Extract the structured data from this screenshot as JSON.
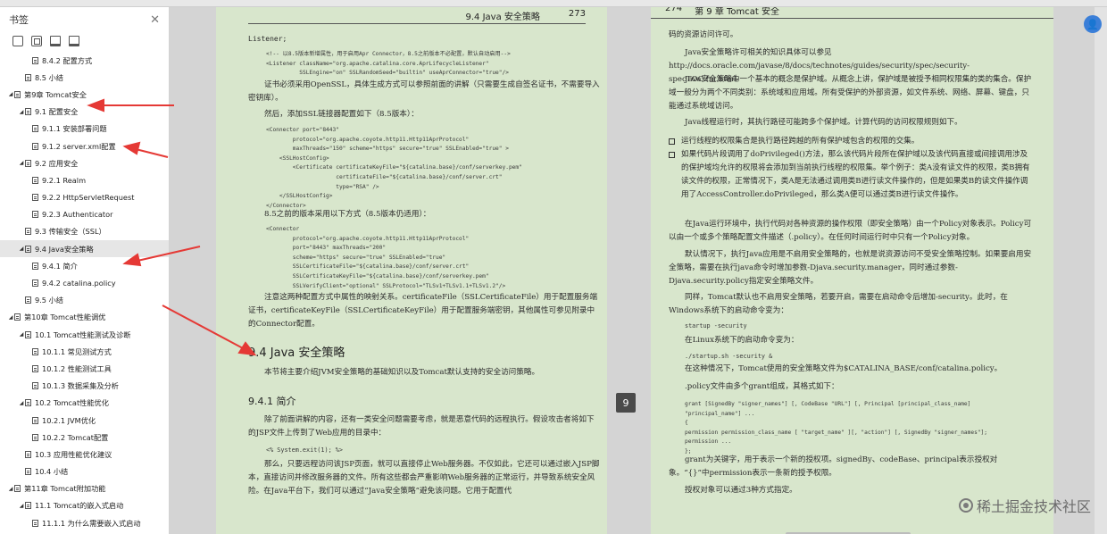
{
  "sidebar": {
    "title": "书签",
    "close_glyph": "✕",
    "toolbar_icons": [
      "bookmark-expand-icon",
      "bookmark-collapse-icon",
      "bookmark-add-icon",
      "bookmark-flag-icon"
    ],
    "items": [
      {
        "label": "8.4.2 配置方式"
      },
      {
        "label": "8.5 小结"
      },
      {
        "label": "第9章 Tomcat安全"
      },
      {
        "label": "9.1 配置安全"
      },
      {
        "label": "9.1.1 安装部署问题"
      },
      {
        "label": "9.1.2 server.xml配置"
      },
      {
        "label": "9.2 应用安全"
      },
      {
        "label": "9.2.1 Realm"
      },
      {
        "label": "9.2.2 HttpServletRequest"
      },
      {
        "label": "9.2.3 Authenticator"
      },
      {
        "label": "9.3 传输安全（SSL）"
      },
      {
        "label": "9.4 Java安全策略"
      },
      {
        "label": "9.4.1 简介"
      },
      {
        "label": "9.4.2 catalina.policy"
      },
      {
        "label": "9.5 小结"
      },
      {
        "label": "第10章 Tomcat性能调优"
      },
      {
        "label": "10.1 Tomcat性能测试及诊断"
      },
      {
        "label": "10.1.1 常见测试方式"
      },
      {
        "label": "10.1.2 性能测试工具"
      },
      {
        "label": "10.1.3 数据采集及分析"
      },
      {
        "label": "10.2 Tomcat性能优化"
      },
      {
        "label": "10.2.1 JVM优化"
      },
      {
        "label": "10.2.2 Tomcat配置"
      },
      {
        "label": "10.3 应用性能优化建议"
      },
      {
        "label": "10.4 小结"
      },
      {
        "label": "第11章 Tomcat附加功能"
      },
      {
        "label": "11.1 Tomcat的嵌入式启动"
      },
      {
        "label": "11.1.1 为什么需要嵌入式启动"
      }
    ]
  },
  "left_page": {
    "header_section": "9.4  Java 安全策略",
    "header_page": "273",
    "line_listener": "Listener;",
    "code1": "<!-- 以8.5版本新增属性，用于启用Apr Connector，8.5之前版本不必配置，默认自动启用-->\n<Listener className=\"org.apache.catalina.core.AprLifecycleListener\"\n          SSLEngine=\"on\" SSLRandomSeed=\"builtin\" useAprConnector=\"true\"/>",
    "para1": "证书必须采用OpenSSL，具体生成方式可以参照前面的讲解（只需要生成自签名证书，不需要导入密钥库）。",
    "para2": "然后，添加SSL链接器配置如下（8.5版本）：",
    "code2": "<Connector port=\"8443\"\n        protocol=\"org.apache.coyote.http11.Http11AprProtocol\"\n        maxThreads=\"150\" scheme=\"https\" secure=\"true\" SSLEnabled=\"true\" >\n    <SSLHostConfig>\n        <Certificate certificateKeyFile=\"${catalina.base}/conf/serverkey.pem\"\n                     certificateFile=\"${catalina.base}/conf/server.crt\"\n                     type=\"RSA\" />\n    </SSLHostConfig>\n</Connector>",
    "para3": "8.5之前的版本采用以下方式（8.5版本仍适用）：",
    "code3": "<Connector\n        protocol=\"org.apache.coyote.http11.Http11AprProtocol\"\n        port=\"8443\" maxThreads=\"200\"\n        scheme=\"https\" secure=\"true\" SSLEnabled=\"true\"\n        SSLCertificateFile=\"${catalina.base}/conf/server.crt\"\n        SSLCertificateKeyFile=\"${catalina.base}/conf/serverkey.pem\"\n        SSLVerifyClient=\"optional\" SSLProtocol=\"TLSv1+TLSv1.1+TLSv1.2\"/>",
    "para4": "注意这两种配置方式中属性的映射关系。certificateFile（SSLCertificateFile）用于配置服务端证书，certificateKeyFile（SSLCertificateKeyFile）用于配置服务端密钥，其他属性可参见附录中的Connector配置。",
    "section_heading": "9.4   Java 安全策略",
    "para5": "本节将主要介绍JVM安全策略的基础知识以及Tomcat默认支持的安全访问策略。",
    "sub_heading": "9.4.1   简介",
    "para6": "除了前面讲解的内容，还有一类安全问题需要考虑，就是恶意代码的远程执行。假设攻击者将如下的JSP文件上传到了Web应用的目录中：",
    "code4": "<% System.exit(1); %>",
    "para7": "那么，只要远程访问该JSP页面，就可以直接停止Web服务器。不仅如此，它还可以通过嵌入JSP脚本，直接访问并修改服务器的文件。所有这些都会严重影响Web服务器的正常运行，并导致系统安全风险。在Java平台下，我们可以通过“Java安全策略”避免该问题。它用于配置代"
  },
  "page_badge": "9",
  "right_page": {
    "header_page": "274",
    "header_chapter": "第 9 章   Tomcat 安全",
    "para1": "码的资源访问许可。",
    "para2": "Java安全策略许可相关的知识具体可以参见http://docs.oracle.com/javase/8/docs/technotes/guides/security/spec/security-specTOC.fm.html。",
    "para3": "Java安全策略中一个基本的概念是保护域。从概念上讲，保护域是被授予相同权限集的类的集合。保护域一般分为两个不同类别：系统域和应用域。所有受保护的外部资源，如文件系统、网络、屏幕、键盘，只能通过系统域访问。",
    "para4": "Java线程运行时，其执行路径可能跨多个保护域。计算代码的访问权限规则如下。",
    "bullet1": "运行线程的权限集合是执行路径跨越的所有保护域包含的权限的交集。",
    "bullet2": "如果代码片段调用了doPrivileged()方法，那么该代码片段所在保护域以及该代码直接或间接调用涉及的保护域均允许的权限将会添加到当前执行线程的权限集。举个例子：类A没有读文件的权限，类B拥有读文件的权限，正常情况下，类A是无法通过调用类B进行读文件操作的，但是如果类B的读文件操作调用了AccessController.doPrivileged，那么类A便可以通过类B进行读文件操作。",
    "para5": "在Java运行环境中，执行代码对各种资源的操作权限（即安全策略）由一个Policy对象表示。Policy可以由一个或多个策略配置文件描述（.policy）。在任何时间运行时中只有一个Policy对象。",
    "para6": "默认情况下，执行Java应用是不启用安全策略的，也就是说资源访问不受安全策略控制。如果要启用安全策略，需要在执行java命令时增加参数-Djava.security.manager，同时通过参数-Djava.security.policy指定安全策略文件。",
    "para7": "同样，Tomcat默认也不启用安全策略，若要开启，需要在启动命令后增加-security。此时，在Windows系统下的启动命令变为：",
    "code1": "startup -security",
    "para8": "在Linux系统下的启动命令变为：",
    "code2": "./startup.sh -security &",
    "para9": "在这种情况下，Tomcat使用的安全策略文件为$CATALINA_BASE/conf/catalina.policy。",
    "para10": ".policy文件由多个grant组成，其格式如下：",
    "code3": "grant [SignedBy \"signer_names\"] [, CodeBase \"URL\"] [, Principal [principal_class_name]\n\"principal_name\"] ...\n{\npermission permission_class_name [ \"target_name\" ][, \"action\"] [, SignedBy \"signer_names\"];\npermission ...\n};",
    "para11": "grant为关键字，用于表示一个新的授权项。signedBy、codeBase、principal表示授权对象。“{}”中permission表示一条新的授予权限。",
    "para12": "授权对象可以通过3种方式指定。"
  },
  "avatar_glyph": "👤",
  "watermark": "稀土掘金技术社区",
  "colors": {
    "page_background": "#d8e6cc",
    "annotation_arrow": "#e53935",
    "active_item": "#e6e6e6"
  }
}
